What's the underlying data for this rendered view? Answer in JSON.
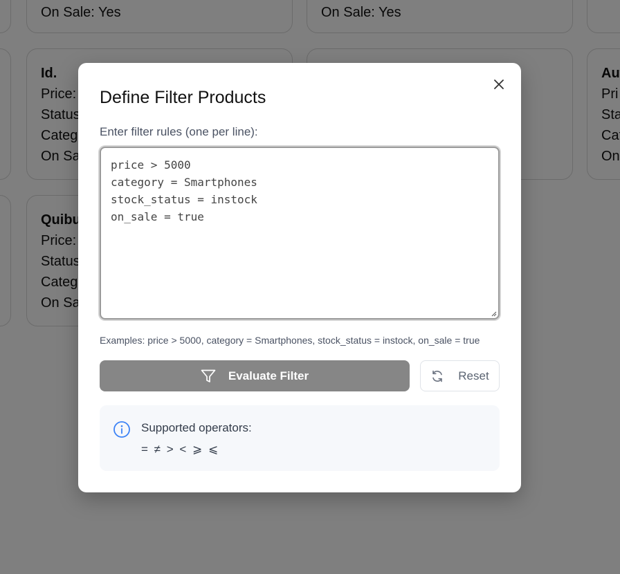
{
  "background_cards": {
    "col1_top": {
      "fields": [
        "On Sale: Yes"
      ]
    },
    "col2_top": {
      "fields": [
        "On Sale: Yes"
      ]
    },
    "col1_mid": {
      "title": "Id.",
      "fields": [
        "Price:",
        "Status",
        "Categ",
        "On Sa"
      ]
    },
    "col3_mid": {
      "title": "Aut",
      "fields": [
        "Pri",
        "Sta",
        "Cat",
        "On"
      ]
    },
    "col1_low": {
      "title": "Quibu",
      "fields": [
        "Price:",
        "Status",
        "Categ",
        "On Sa"
      ]
    }
  },
  "modal": {
    "title": "Define Filter Products",
    "close_icon": "close-icon",
    "rules_label": "Enter filter rules (one per line):",
    "rules_value": "price > 5000\ncategory = Smartphones\nstock_status = instock\non_sale = true",
    "examples": "Examples: price > 5000, category = Smartphones, stock_status = instock, on_sale = true",
    "evaluate_label": "Evaluate Filter",
    "evaluate_icon": "filter-icon",
    "reset_label": "Reset",
    "reset_icon": "refresh-icon",
    "info": {
      "icon": "info-icon",
      "title": "Supported operators:",
      "operators": "= ≠ > < ⩾ ⩽"
    }
  },
  "colors": {
    "overlay": "rgba(0,0,0,0.5)",
    "evaluate_bg": "#868686",
    "info_bg": "#f6f8fb",
    "info_icon": "#3b82f6"
  }
}
